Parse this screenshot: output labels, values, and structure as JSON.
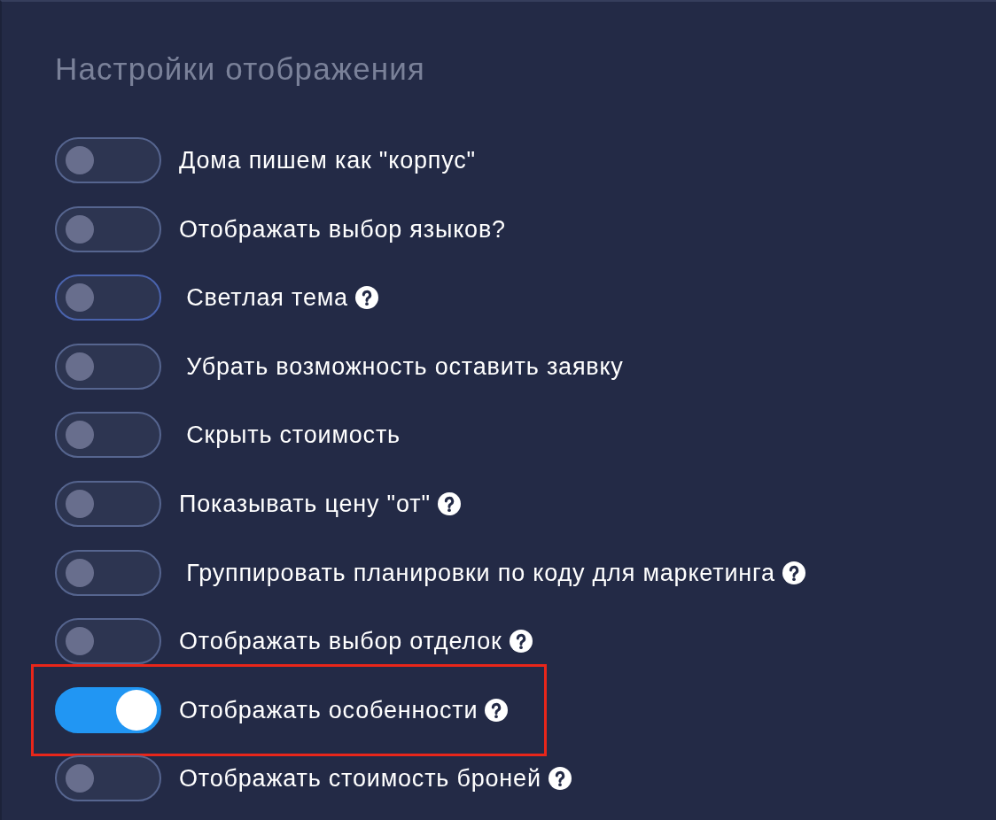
{
  "panel": {
    "title": "Настройки отображения"
  },
  "settings": [
    {
      "label": "Дома пишем как \"корпус\"",
      "on": false,
      "focused": false,
      "help_icon": false,
      "highlighted": false
    },
    {
      "label": "Отображать выбор языков?",
      "on": false,
      "focused": false,
      "help_icon": false,
      "highlighted": false
    },
    {
      "label": " Светлая тема",
      "on": false,
      "focused": true,
      "help_icon": true,
      "highlighted": false
    },
    {
      "label": " Убрать возможность оставить заявку",
      "on": false,
      "focused": false,
      "help_icon": false,
      "highlighted": false
    },
    {
      "label": " Скрыть стоимость",
      "on": false,
      "focused": false,
      "help_icon": false,
      "highlighted": false
    },
    {
      "label": "Показывать цену \"от\"",
      "on": false,
      "focused": false,
      "help_icon": true,
      "highlighted": false
    },
    {
      "label": " Группировать планировки по коду для маркетинга",
      "on": false,
      "focused": false,
      "help_icon": true,
      "highlighted": false
    },
    {
      "label": "Отображать выбор отделок",
      "on": false,
      "focused": false,
      "help_icon": true,
      "highlighted": false
    },
    {
      "label": "Отображать особенности",
      "on": true,
      "focused": false,
      "help_icon": true,
      "highlighted": true
    },
    {
      "label": "Отображать стоимость броней",
      "on": false,
      "focused": false,
      "help_icon": true,
      "highlighted": false
    }
  ]
}
